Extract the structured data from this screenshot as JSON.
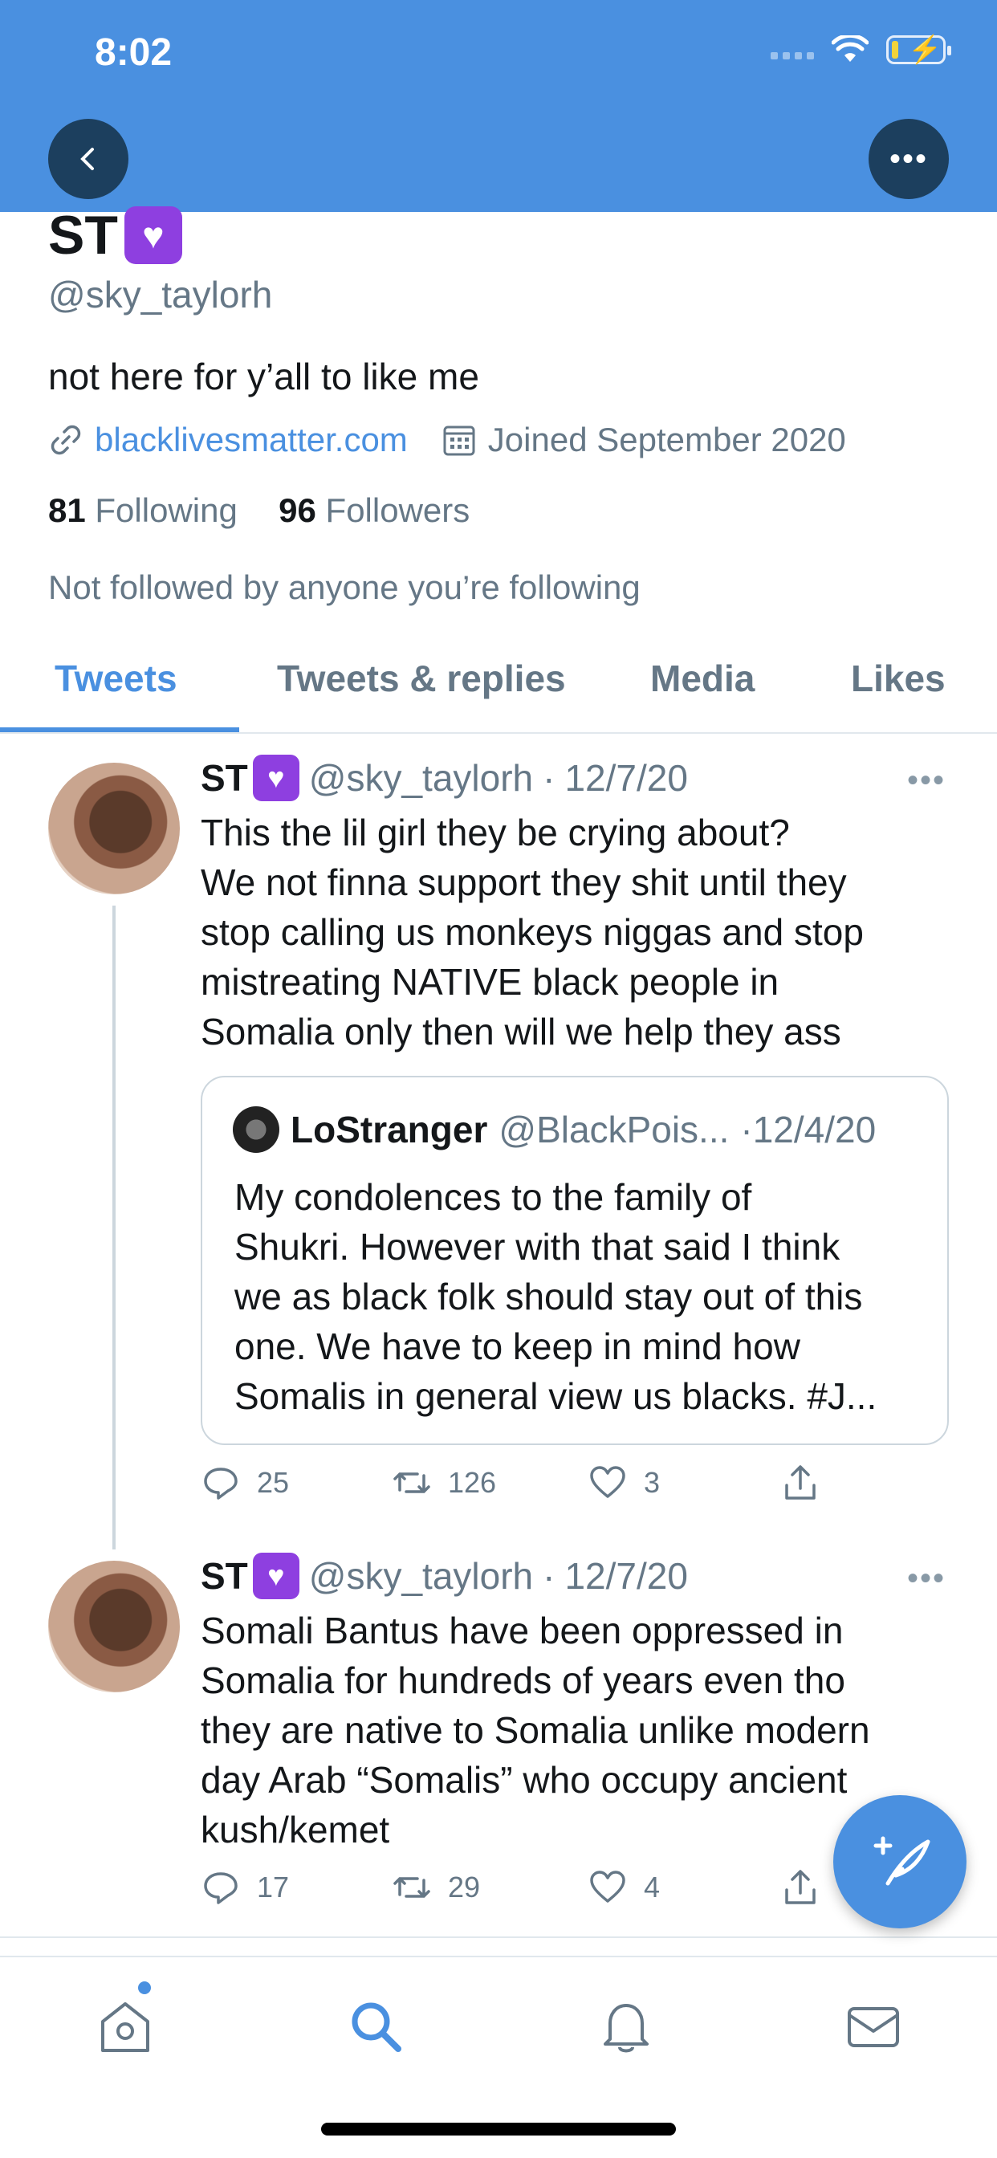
{
  "status_bar": {
    "time": "8:02"
  },
  "header": {
    "back_icon": "chevron-left-icon",
    "more_icon": "more-horizontal-icon"
  },
  "profile": {
    "name": "ST",
    "handle": "@sky_taylorh",
    "bio": "not here for y’all to like me",
    "website": "blacklivesmatter.com",
    "joined": "Joined September 2020",
    "following_count": "81",
    "following_label": "Following",
    "followers_count": "96",
    "followers_label": "Followers",
    "not_followed_text": "Not followed by anyone you’re following"
  },
  "tabs": [
    {
      "label": "Tweets",
      "active": true
    },
    {
      "label": "Tweets & replies",
      "active": false
    },
    {
      "label": "Media",
      "active": false
    },
    {
      "label": "Likes",
      "active": false
    }
  ],
  "tweets": [
    {
      "name": "ST",
      "handle": "@sky_taylorh",
      "separator": "·",
      "date": "12/7/20",
      "text": "This the lil girl they be crying about?\nWe not finna support they shit until they\nstop calling us monkeys niggas and stop\nmistreating NATIVE black people in\nSomalia only then will we help they ass",
      "quote": {
        "name": "LoStranger",
        "handle": "@BlackPois...",
        "date": "·12/4/20",
        "text": "My condolences to the family of\nShukri. However with that said I think\nwe as black folk should stay out of this\none. We have to keep in mind how\nSomalis in general view us blacks. #J..."
      },
      "replies": "25",
      "retweets": "126",
      "likes": "3"
    },
    {
      "name": "ST",
      "handle": "@sky_taylorh",
      "separator": "·",
      "date": "12/7/20",
      "text": "Somali Bantus have been oppressed in\nSomalia for hundreds of years even tho\nthey are native to Somalia unlike modern\nday Arab “Somalis” who occupy ancient\nkush/kemet",
      "replies": "17",
      "retweets": "29",
      "likes": "4"
    }
  ],
  "bottom_nav": [
    "home-icon",
    "search-icon",
    "bell-icon",
    "mail-icon"
  ],
  "colors": {
    "accent": "#4a90e0",
    "header_bg": "#4a90e0",
    "badge": "#8e3fe0"
  }
}
